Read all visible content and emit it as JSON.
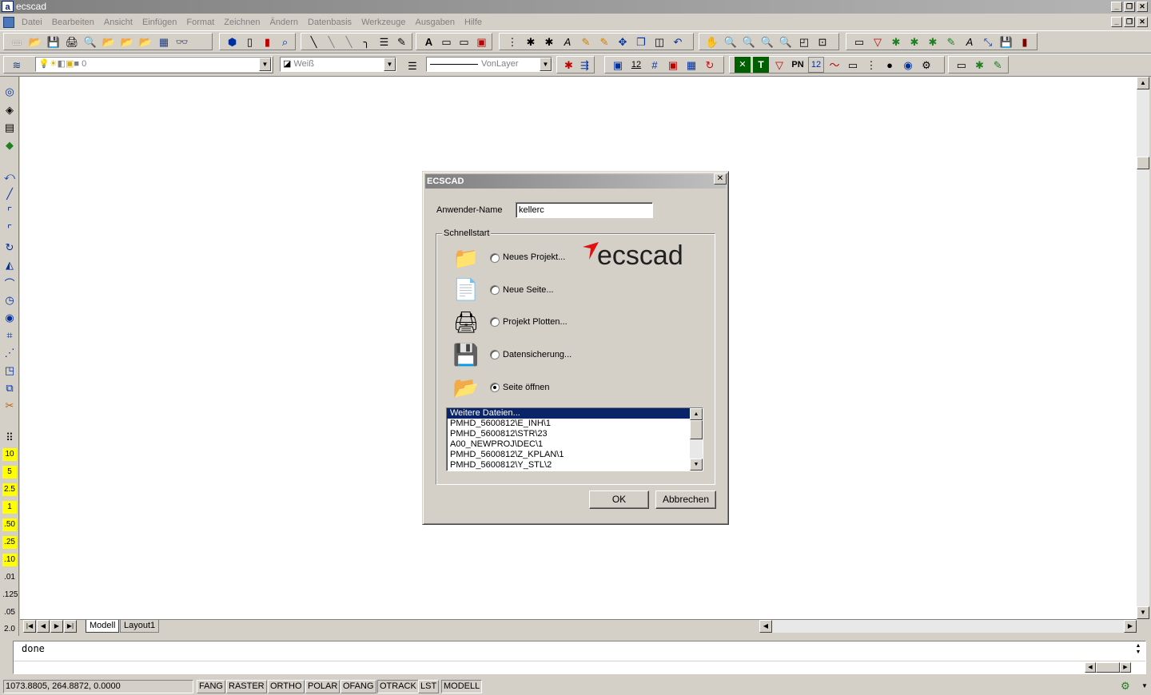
{
  "window": {
    "title": "ecscad",
    "app_icon": "a"
  },
  "menu": [
    "Datei",
    "Bearbeiten",
    "Ansicht",
    "Einfügen",
    "Format",
    "Zeichnen",
    "Ändern",
    "Datenbasis",
    "Werkzeuge",
    "Ausgaben",
    "Hilfe"
  ],
  "toolbar2": {
    "layer_value": "0",
    "color_value": "Weiß",
    "linetype_value": "VonLayer",
    "pn_label": "PN",
    "number_label": "12"
  },
  "left_scale": [
    "10",
    "5",
    "2.5",
    "1",
    ".50",
    ".25",
    ".10",
    ".01",
    ".125",
    ".05",
    "2.0"
  ],
  "tabs": [
    "Modell",
    "Layout1"
  ],
  "command": {
    "text": "done"
  },
  "status": {
    "coords": "1073.8805, 264.8872, 0.0000",
    "buttons": [
      "FANG",
      "RASTER",
      "ORTHO",
      "POLAR",
      "OFANG",
      "OTRACK",
      "LST",
      "MODELL"
    ]
  },
  "dialog": {
    "title": "ECSCAD",
    "user_label": "Anwender-Name",
    "user_value": "kellerc",
    "group_label": "Schnellstart",
    "logo_text": "ecscad",
    "options": [
      "Neues Projekt...",
      "Neue Seite...",
      "Projekt Plotten...",
      "Datensicherung...",
      "Seite öffnen"
    ],
    "selected_option": 4,
    "files": [
      "Weitere Dateien...",
      "PMHD_5600812\\E_INH\\1",
      "PMHD_5600812\\STR\\23",
      "A00_NEWPROJ\\DEC\\1",
      "PMHD_5600812\\Z_KPLAN\\1",
      "PMHD_5600812\\Y_STL\\2"
    ],
    "ok_label": "OK",
    "cancel_label": "Abbrechen"
  }
}
